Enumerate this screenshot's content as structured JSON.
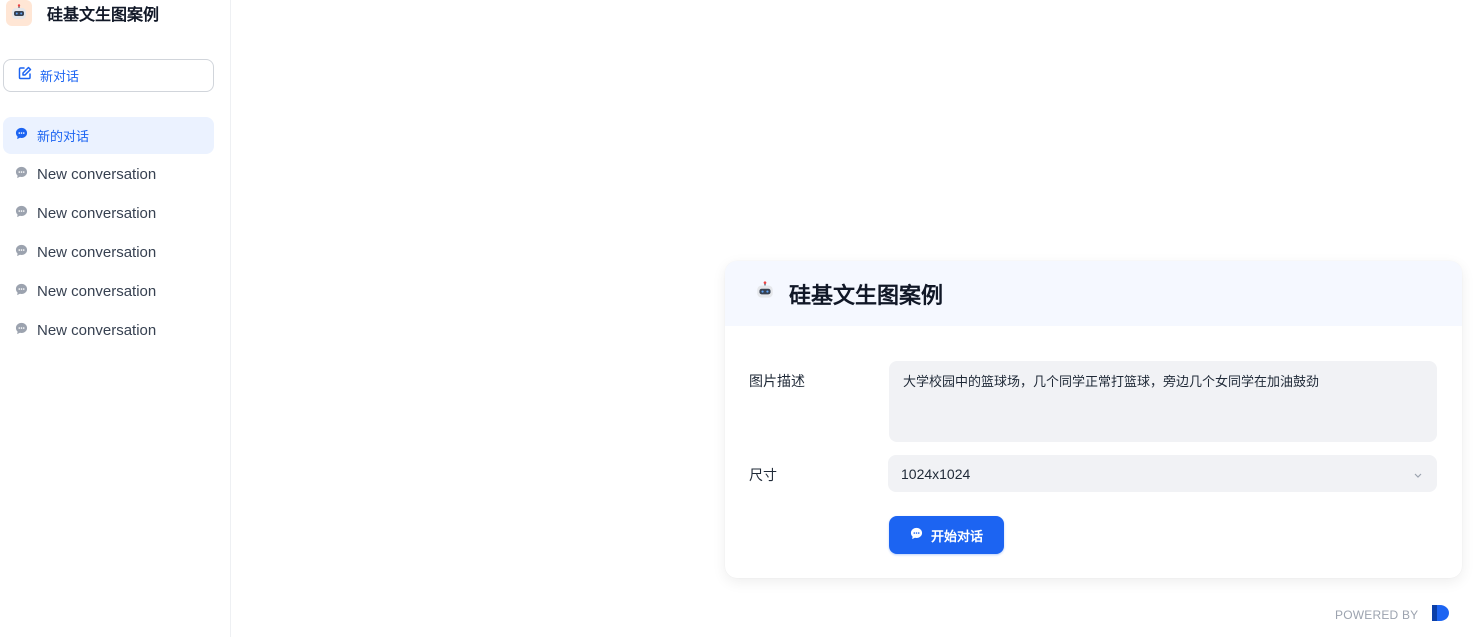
{
  "app": {
    "title": "硅基文生图案例"
  },
  "sidebar": {
    "new_chat_label": "新对话",
    "conversations": [
      {
        "label": "新的对话",
        "active": true
      },
      {
        "label": "New conversation",
        "active": false
      },
      {
        "label": "New conversation",
        "active": false
      },
      {
        "label": "New conversation",
        "active": false
      },
      {
        "label": "New conversation",
        "active": false
      },
      {
        "label": "New conversation",
        "active": false
      }
    ]
  },
  "form": {
    "title": "硅基文生图案例",
    "description_label": "图片描述",
    "description_value": "大学校园中的篮球场，几个同学正常打篮球，旁边几个女同学在加油鼓劲",
    "size_label": "尺寸",
    "size_value": "1024x1024",
    "start_button_label": "开始对话"
  },
  "footer": {
    "powered_by": "POWERED BY"
  },
  "colors": {
    "accent": "#1c64f2",
    "active_bg": "#ebf2ff",
    "header_bg": "#f5f8ff",
    "field_bg": "#f1f2f5"
  }
}
